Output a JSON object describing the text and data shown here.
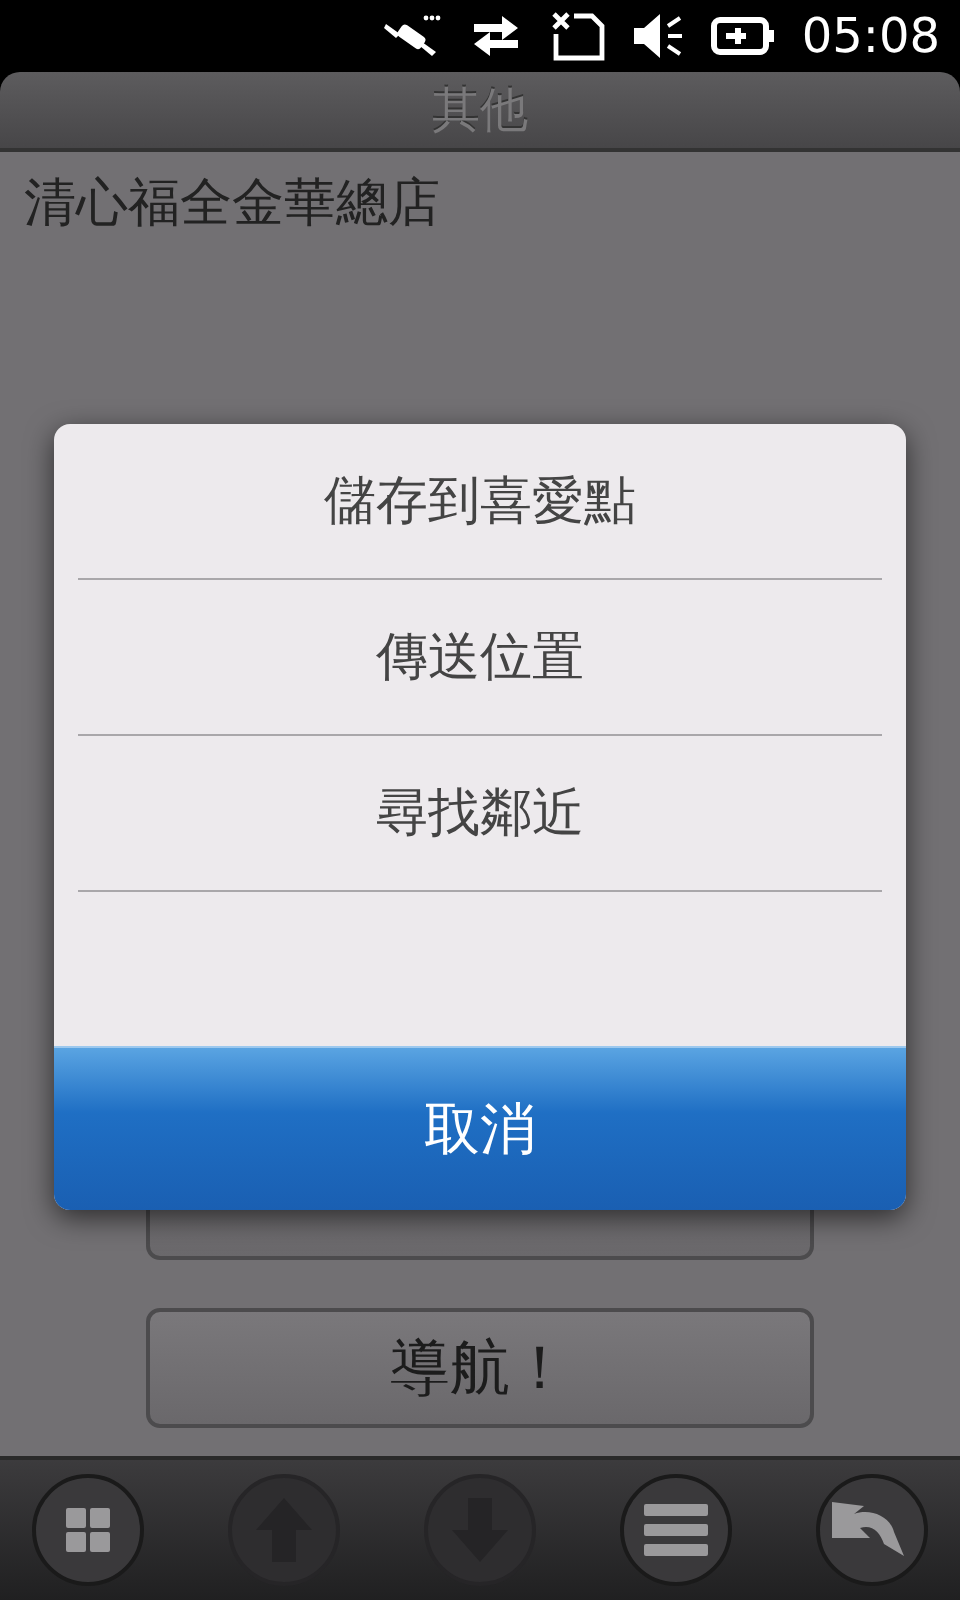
{
  "status_bar": {
    "icons": [
      {
        "kind": "satellite"
      },
      {
        "kind": "data"
      },
      {
        "kind": "no-sim"
      },
      {
        "kind": "muted"
      },
      {
        "kind": "battery"
      }
    ],
    "time": "05:08"
  },
  "title_bar": {
    "title": "其他"
  },
  "place_name": "清心福全金華總店",
  "buttons": [
    {
      "kind": "covered"
    },
    {
      "kind": "text",
      "label": "導航！"
    }
  ],
  "dialog": {
    "options": [
      {
        "label": "儲存到喜愛點"
      },
      {
        "label": "傳送位置"
      },
      {
        "label": "尋找鄰近"
      }
    ],
    "cancel": "取消"
  },
  "toolbar": [
    {
      "kind": "windows",
      "disabled": false
    },
    {
      "kind": "up",
      "disabled": true
    },
    {
      "kind": "down",
      "disabled": true
    },
    {
      "kind": "menu",
      "disabled": false
    },
    {
      "kind": "back",
      "disabled": false
    }
  ]
}
